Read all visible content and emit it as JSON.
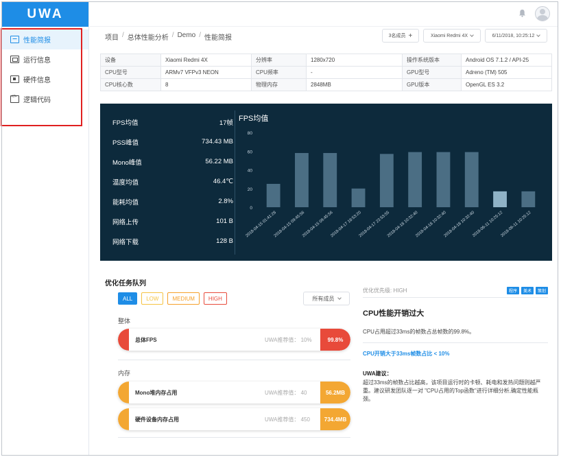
{
  "app": {
    "logo": "UWA"
  },
  "sidebar": {
    "items": [
      {
        "label": "性能简报",
        "icon": "pulse-icon",
        "active": true
      },
      {
        "label": "运行信息",
        "icon": "window-icon",
        "active": false
      },
      {
        "label": "硬件信息",
        "icon": "chip-icon",
        "active": false
      },
      {
        "label": "逻辑代码",
        "icon": "code-icon",
        "active": false
      }
    ]
  },
  "breadcrumb": [
    "项目",
    "总体性能分析",
    "Demo",
    "性能简报"
  ],
  "controls": {
    "members": "3名成员",
    "members_add": "+",
    "device": "Xiaomi Redmi 4X",
    "datetime": "6/11/2018, 10:25:12"
  },
  "device_info": [
    [
      "设备",
      "Xiaomi Redmi 4X",
      "分辨率",
      "1280x720",
      "操作系统版本",
      "Android OS 7.1.2 / API-25"
    ],
    [
      "CPU型号",
      "ARMv7 VFPv3 NEON",
      "CPU频率",
      "-",
      "GPU型号",
      "Adreno (TM) 505"
    ],
    [
      "CPU核心数",
      "8",
      "物理内存",
      "2848MB",
      "GPU版本",
      "OpenGL ES 3.2"
    ]
  ],
  "stats": [
    {
      "label": "FPS均值",
      "value": "17帧"
    },
    {
      "label": "PSS峰值",
      "value": "734.43 MB"
    },
    {
      "label": "Mono峰值",
      "value": "56.22 MB"
    },
    {
      "label": "温度均值",
      "value": "46.4℃"
    },
    {
      "label": "能耗均值",
      "value": "2.8%"
    },
    {
      "label": "网络上传",
      "value": "101 B"
    },
    {
      "label": "网络下载",
      "value": "128 B"
    }
  ],
  "chart_data": {
    "type": "bar",
    "title": "FPS均值",
    "categories": [
      "2018-04-15 01:41:28",
      "2018-04-15 09:45:56",
      "2018-04-15 09:45:56",
      "2018-04-17 18:53:20",
      "2018-04-17 23:53:55",
      "2018-04-18 10:32:40",
      "2018-04-18 10:32:40",
      "2018-04-18 10:32:40",
      "2018-06-11 10:25:12",
      "2018-06-11 10:25:12"
    ],
    "values": [
      25,
      58,
      58,
      20,
      57,
      59,
      59,
      59,
      17,
      17
    ],
    "highlight_index": 8,
    "ylim": [
      0,
      80
    ],
    "yticks": [
      "0",
      "20",
      "40",
      "60",
      "80"
    ],
    "grid": false,
    "colors": {
      "bar": "#4b6e84",
      "highlight": "#8fb2c6",
      "background": "#0d2a3c"
    }
  },
  "tasks": {
    "title": "优化任务队列",
    "filters": [
      {
        "label": "ALL",
        "color": "#1e8de6",
        "active": true
      },
      {
        "label": "LOW",
        "color": "#f5c342",
        "active": false
      },
      {
        "label": "MEDIUM",
        "color": "#f5a02a",
        "active": false
      },
      {
        "label": "HIGH",
        "color": "#e84a3a",
        "active": false
      }
    ],
    "members_filter": "所有成员",
    "groups": [
      {
        "name": "整体",
        "items": [
          {
            "name": "总体FPS",
            "rec": "UWA推荐值： 10%",
            "value": "99.8%",
            "color": "#e84a3a"
          }
        ]
      },
      {
        "name": "内存",
        "items": [
          {
            "name": "Mono堆内存占用",
            "rec": "UWA推荐值： 40",
            "value": "56.2MB",
            "color": "#f3a733"
          },
          {
            "name": "硬件设备内存占用",
            "rec": "UWA推荐值： 450",
            "value": "734.4MB",
            "color": "#f3a733"
          }
        ]
      }
    ]
  },
  "detail": {
    "priority": "优化优先级: HIGH",
    "tags": [
      "程序",
      "美术",
      "策划"
    ],
    "title": "CPU性能开销过大",
    "desc": "CPU占用超过33ms的帧数占总帧数的99.8%。",
    "metric": "CPU开销大于33ms帧数占比 < 10%",
    "suggestion_title": "UWA建议：",
    "suggestion": "超过33ms的帧数占比越高，该项目运行时的卡顿、耗电和发热问题则越严重。建议研发团队逐一对 \"CPU占用的Top函数\"进行详细分析,确定性能瓶颈。"
  }
}
